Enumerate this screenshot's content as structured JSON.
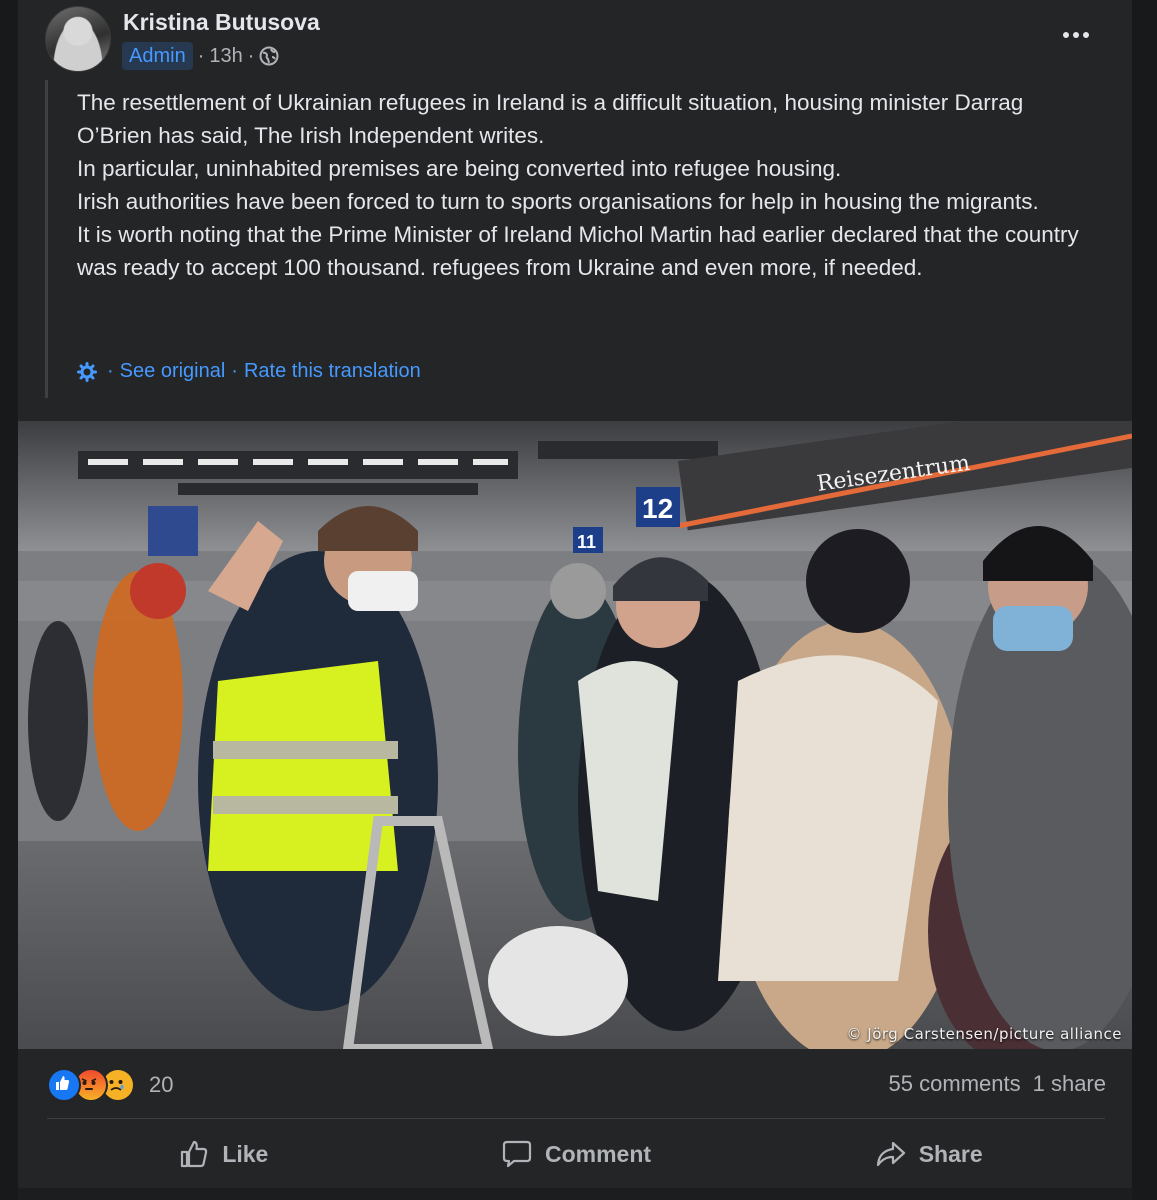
{
  "post": {
    "author": "Kristina Butusova",
    "badge": "Admin",
    "time": "13h",
    "separator": "·",
    "privacy_icon": "globe-icon",
    "more_icon": "more-options-icon",
    "paragraphs": [
      "The resettlement of Ukrainian refugees in Ireland is a difficult situation, housing minister Darrag O’Brien has said, The Irish Independent writes.",
      "In particular, uninhabited premises are being converted into refugee housing.",
      "Irish authorities have been forced to turn to sports organisations for help in housing the migrants.",
      "It is worth noting that the Prime Minister of Ireland Michol Martin had earlier declared that the country was ready to accept 100 thousand. refugees from Ukraine and even more, if needed."
    ],
    "translation": {
      "see_original": "See original",
      "rate": "Rate this translation"
    },
    "photo": {
      "credit": "© Jörg Carstensen/picture alliance",
      "sign_12": "12",
      "sign_11": "11",
      "shop_sign": "Reisezentrum"
    }
  },
  "engagement": {
    "reaction_icons": [
      "like-reaction-icon",
      "angry-reaction-icon",
      "sad-reaction-icon"
    ],
    "reaction_count": "20",
    "comments": "55 comments",
    "shares": "1 share"
  },
  "actions": {
    "like": "Like",
    "comment": "Comment",
    "share": "Share"
  },
  "colors": {
    "background": "#18191a",
    "card": "#242526",
    "text": "#e4e6eb",
    "secondary_text": "#b0b3b8",
    "link": "#4599ff",
    "badge_bg": "#263951"
  }
}
